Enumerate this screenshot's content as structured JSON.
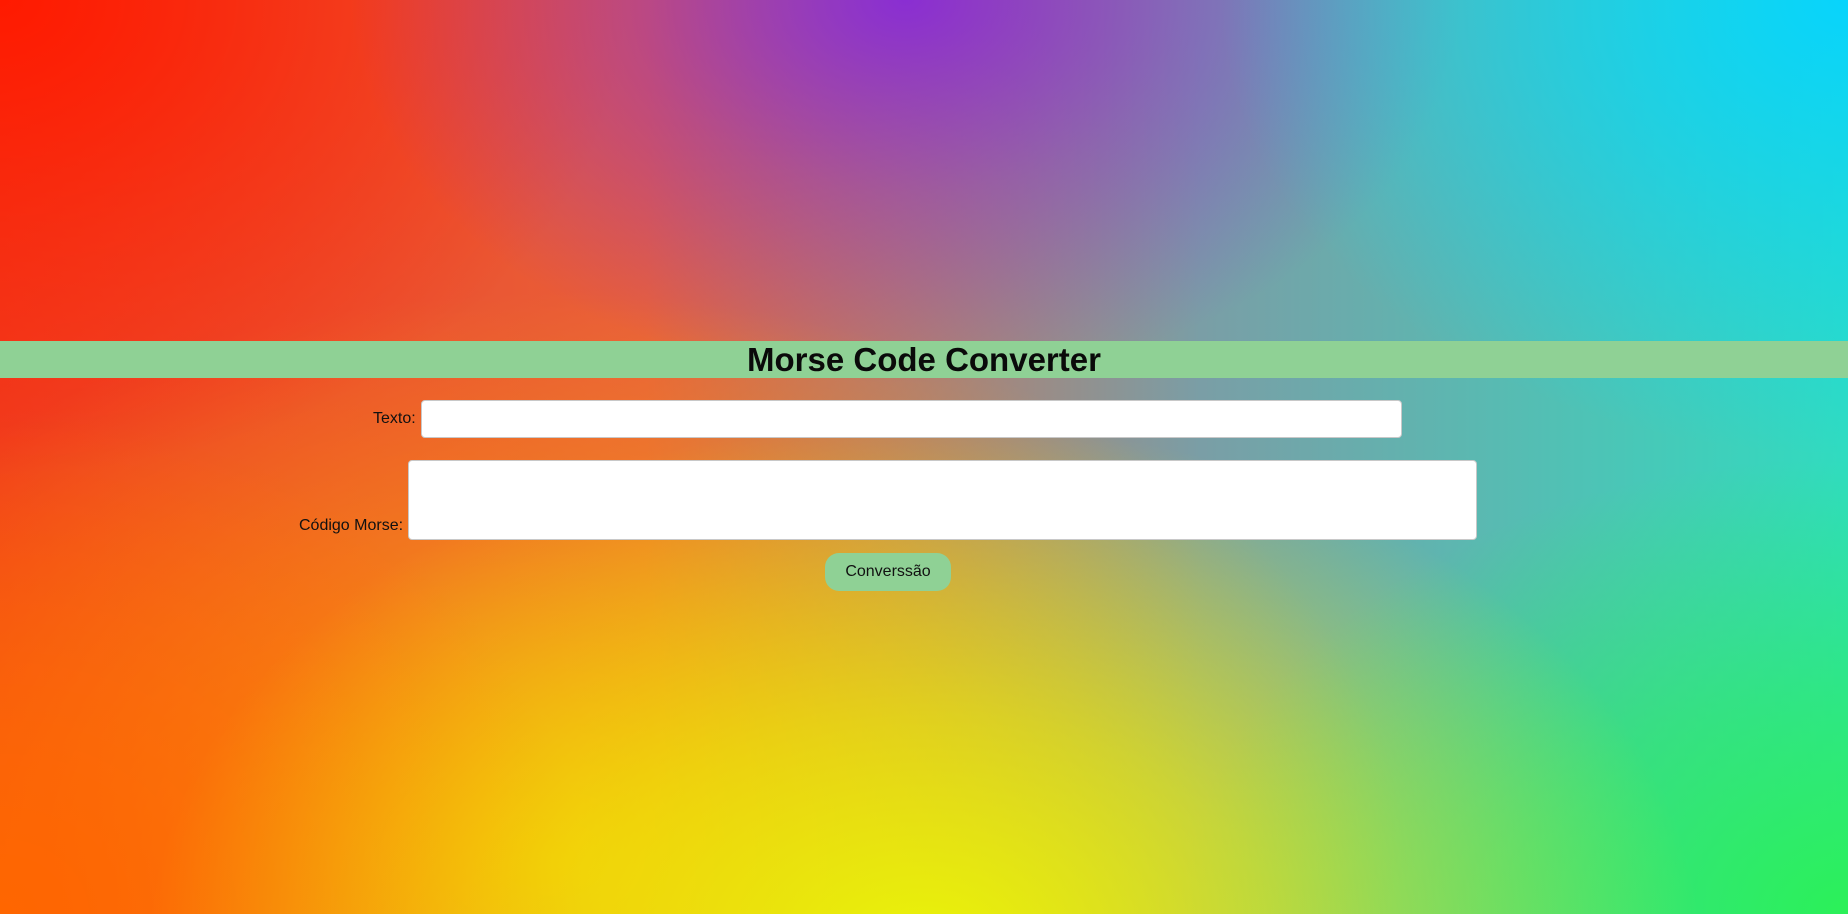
{
  "header": {
    "title": "Morse Code Converter"
  },
  "form": {
    "text_label": "Texto:",
    "text_value": "",
    "morse_label": "Código Morse:",
    "morse_value": "",
    "convert_button_label": "Converssão"
  },
  "colors": {
    "header_bar": "#8fd195",
    "button": "#8fd195",
    "gradient_top_left": "#ff1a00",
    "gradient_top_center": "#8a2ed2",
    "gradient_top_right": "#08d4fc",
    "gradient_bottom_left": "#ff6600",
    "gradient_bottom_center": "#eaf408",
    "gradient_bottom_right": "#2cf058"
  }
}
